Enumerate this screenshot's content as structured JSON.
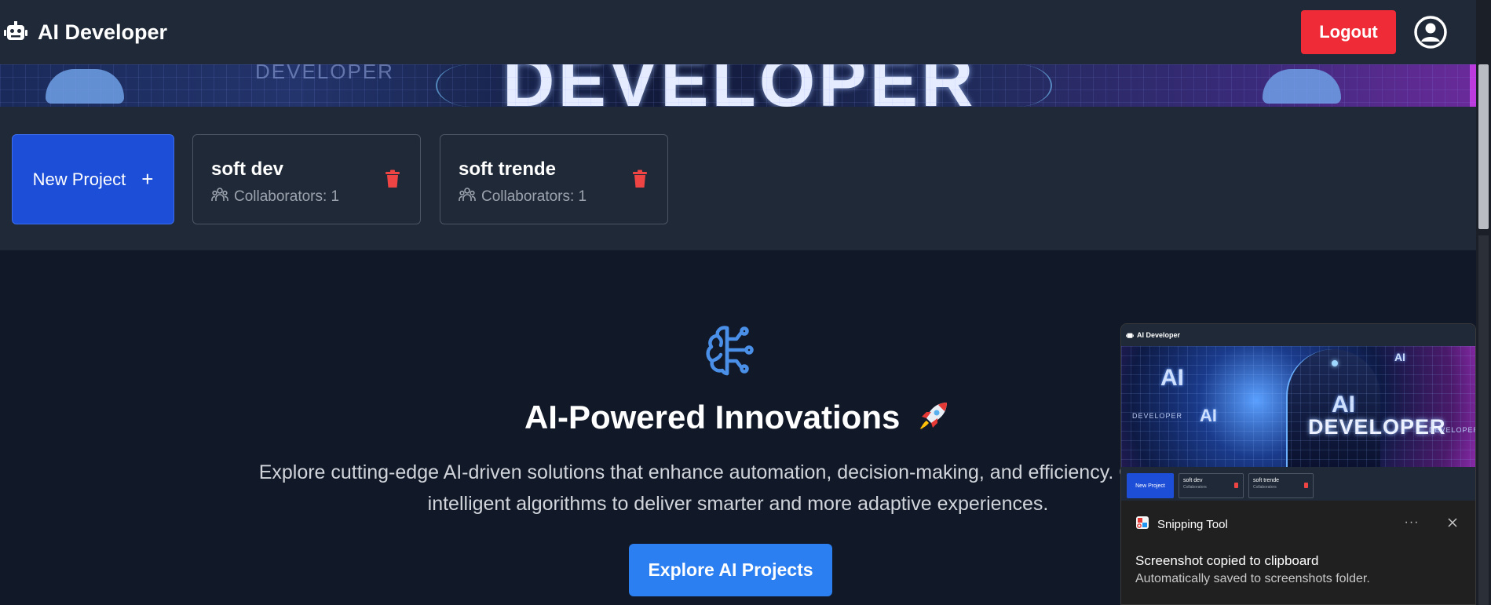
{
  "header": {
    "title": "AI Developer",
    "logout_label": "Logout",
    "brand_icon": "robot-icon",
    "user_icon": "user-circle-icon"
  },
  "banner": {
    "text": "DEVELOPER",
    "small_text": "DEVELOPER"
  },
  "projects": {
    "new_project_label": "New Project",
    "new_project_icon": "+",
    "items": [
      {
        "name": "soft dev",
        "collaborators": "Collaborators: 1"
      },
      {
        "name": "soft trende",
        "collaborators": "Collaborators: 1"
      }
    ]
  },
  "hero": {
    "icon": "brain-circuit-icon",
    "title": "AI-Powered Innovations",
    "emoji": "rocket-icon",
    "description": "Explore cutting-edge AI-driven solutions that enhance automation, decision-making, and efficiency. Our AI-pow",
    "description_line2": "intelligent algorithms to deliver smarter and more adaptive experiences.",
    "button_label": "Explore AI Projects"
  },
  "toast": {
    "app_name": "Snipping Tool",
    "title": "Screenshot copied to clipboard",
    "subtitle": "Automatically saved to screenshots folder.",
    "more_label": "···",
    "thumbnail": {
      "header": "AI Developer",
      "ai_text": "AI",
      "developer_text": "DEVELOPER",
      "big_text_1": "AI",
      "big_text_2": "DEVELOPER",
      "new_project": "New Project",
      "card1": "soft dev",
      "card2": "soft trende",
      "card_sub": "Collaborators"
    }
  },
  "colors": {
    "header_bg": "#1f2937",
    "page_bg": "#111827",
    "logout": "#ef2b37",
    "new_project": "#1d4ed8",
    "explore": "#2b7ff0",
    "trash": "#ef4444",
    "hero_icon": "#4a8fe8"
  }
}
